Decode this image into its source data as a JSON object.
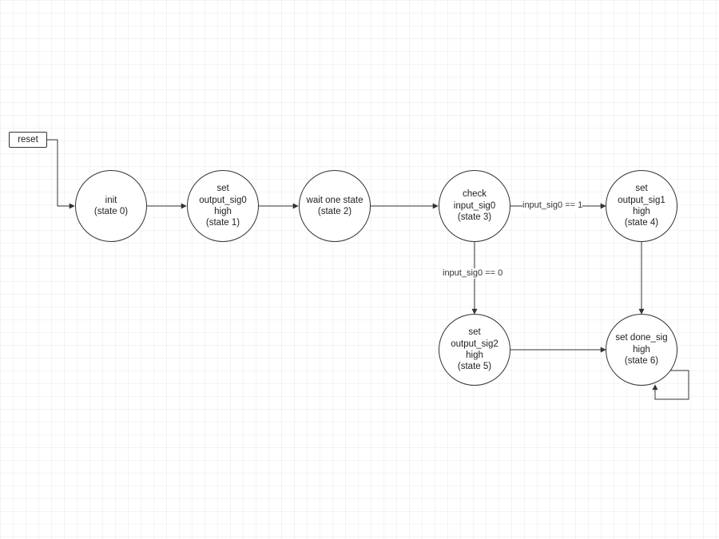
{
  "reset": {
    "label": "reset"
  },
  "states": {
    "s0": {
      "text": "init\n(state 0)"
    },
    "s1": {
      "text": "set\noutput_sig0\nhigh\n(state 1)"
    },
    "s2": {
      "text": "wait one state\n(state 2)"
    },
    "s3": {
      "text": "check\ninput_sig0\n(state 3)"
    },
    "s4": {
      "text": "set\noutput_sig1\nhigh\n(state 4)"
    },
    "s5": {
      "text": "set\noutput_sig2\nhigh\n(state 5)"
    },
    "s6": {
      "text": "set done_sig\nhigh\n(state 6)"
    }
  },
  "edge_labels": {
    "s3_s4": "input_sig0 == 1",
    "s3_s5": "input_sig0 == 0"
  }
}
